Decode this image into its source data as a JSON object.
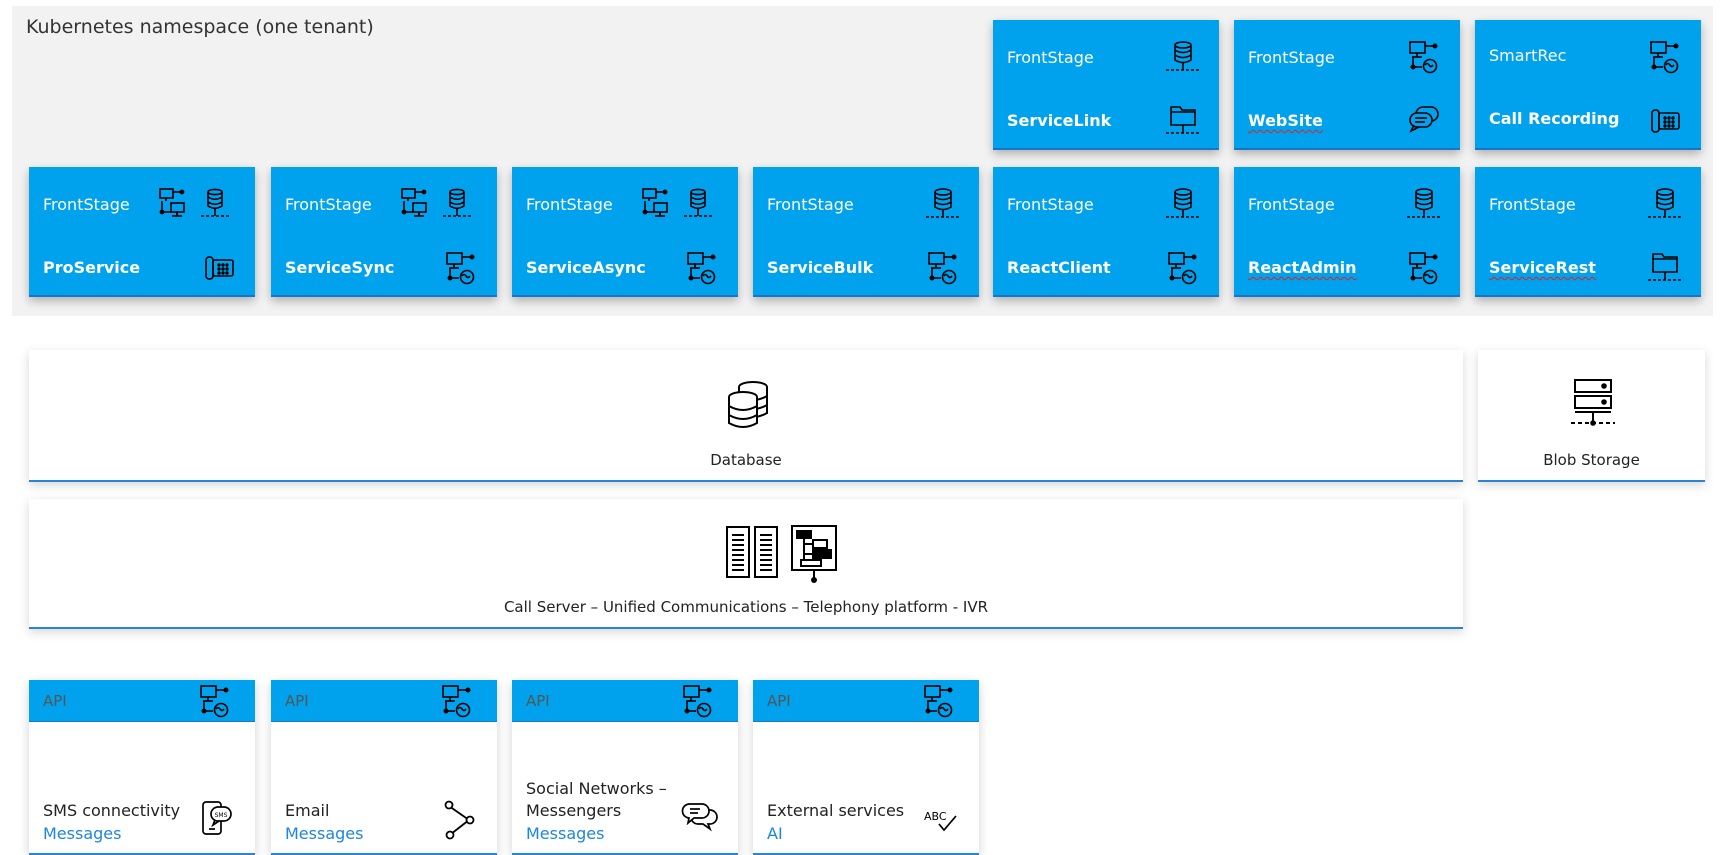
{
  "namespace": {
    "title": "Kubernetes namespace (one tenant)"
  },
  "colors": {
    "tile": "#00a2ed",
    "accent_line": "#2a83d4",
    "namespace_bg": "#f2f2f2",
    "link_text": "#1a86e0"
  },
  "top_row": [
    {
      "top": "FrontStage",
      "bottom": "ServiceLink",
      "icon_top": "database-icon",
      "icon_bottom": "folder-icon"
    },
    {
      "top": "FrontStage",
      "bottom": "WebSite",
      "icon_top": "network-globe-icon",
      "icon_bottom": "chat-icon"
    },
    {
      "top": "SmartRec",
      "bottom": "Call Recording",
      "icon_top": "network-globe-icon",
      "icon_bottom": "phone-icon"
    }
  ],
  "second_row": [
    {
      "top": "FrontStage",
      "bottom": "ProService",
      "icon_top": "network-database-icon",
      "icon_bottom": "phone-icon"
    },
    {
      "top": "FrontStage",
      "bottom": "ServiceSync",
      "icon_top": "network-database-icon",
      "icon_bottom": "network-globe-icon"
    },
    {
      "top": "FrontStage",
      "bottom": "ServiceAsync",
      "icon_top": "network-database-icon",
      "icon_bottom": "network-globe-icon"
    },
    {
      "top": "FrontStage",
      "bottom": "ServiceBulk",
      "icon_top": "database-icon",
      "icon_bottom": "network-globe-icon"
    },
    {
      "top": "FrontStage",
      "bottom": "ReactClient",
      "icon_top": "database-icon",
      "icon_bottom": "network-globe-icon"
    },
    {
      "top": "FrontStage",
      "bottom": "ReactAdmin",
      "icon_top": "database-icon",
      "icon_bottom": "network-globe-icon"
    },
    {
      "top": "FrontStage",
      "bottom": "ServiceRest",
      "icon_top": "database-icon",
      "icon_bottom": "folder-icon"
    }
  ],
  "database": {
    "label": "Database",
    "icon": "databases-icon"
  },
  "blob": {
    "label": "Blob Storage",
    "icon": "storage-server-icon"
  },
  "callserver": {
    "label": "Call Server – Unified Communications – Telephony platform - IVR",
    "icons": [
      "server-rack-icon",
      "flowchart-board-icon"
    ]
  },
  "apis": [
    {
      "header": "API",
      "title1": "",
      "title2": "SMS connectivity",
      "sub": "Messages",
      "icon": "sms-phone-icon"
    },
    {
      "header": "API",
      "title1": "",
      "title2": "Email",
      "sub": "Messages",
      "icon": "share-icon"
    },
    {
      "header": "API",
      "title1": "Social Networks –",
      "title2": "Messengers",
      "sub": "Messages",
      "icon": "conversation-icon"
    },
    {
      "header": "API",
      "title1": "",
      "title2": "External services",
      "sub": "AI",
      "icon": "spellcheck-icon"
    }
  ]
}
